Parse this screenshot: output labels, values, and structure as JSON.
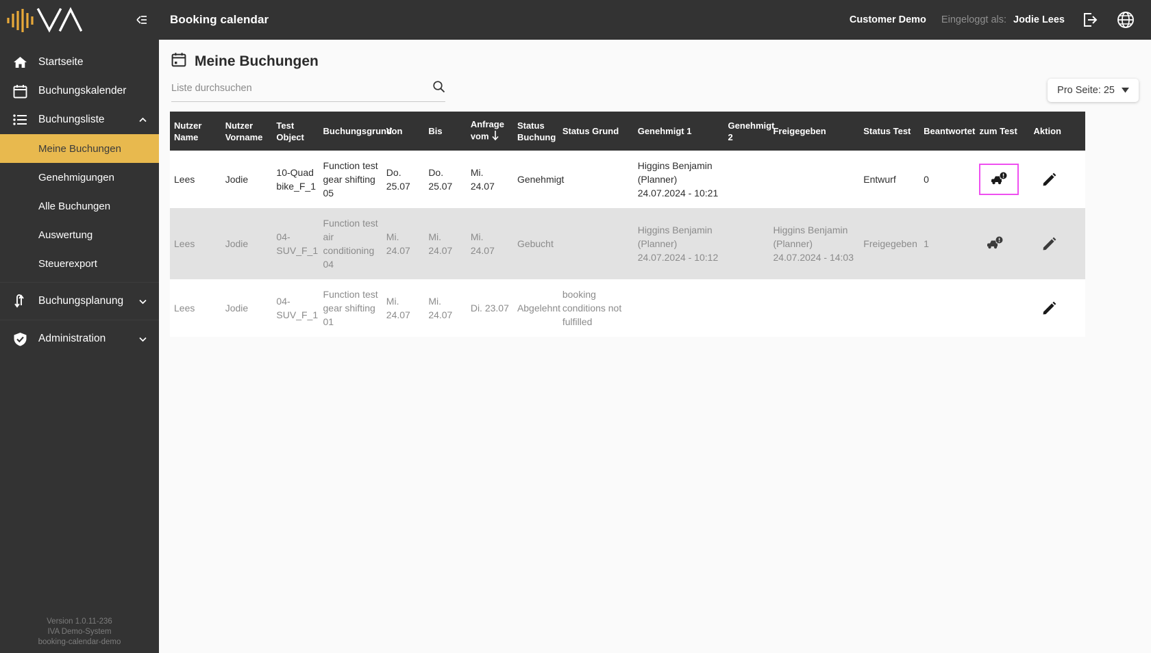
{
  "sidebar": {
    "logo_name": "iva-logo",
    "collapse_icon": "collapse-panel-icon",
    "items": [
      {
        "label": "Startseite",
        "icon": "home-icon",
        "type": "link"
      },
      {
        "label": "Buchungskalender",
        "icon": "calendar-icon",
        "type": "link"
      },
      {
        "label": "Buchungsliste",
        "icon": "list-icon",
        "type": "group",
        "expanded": true,
        "chevron": "chevron-up-icon"
      },
      {
        "label": "Meine Buchungen",
        "type": "sub",
        "active": true
      },
      {
        "label": "Genehmigungen",
        "type": "sub",
        "active": false
      },
      {
        "label": "Alle Buchungen",
        "type": "sub",
        "active": false
      },
      {
        "label": "Auswertung",
        "type": "sub",
        "active": false
      },
      {
        "label": "Steuerexport",
        "type": "sub",
        "active": false
      },
      {
        "label": "Buchungsplanung",
        "icon": "swap-icon",
        "type": "group",
        "expanded": false,
        "chevron": "chevron-down-icon"
      },
      {
        "label": "Administration",
        "icon": "shield-check-icon",
        "type": "group",
        "expanded": false,
        "chevron": "chevron-down-icon"
      }
    ],
    "footer": {
      "version": "Version 1.0.11-236",
      "system": "IVA Demo-System",
      "tenant": "booking-calendar-demo"
    }
  },
  "header": {
    "title": "Booking calendar",
    "customer": "Customer Demo",
    "logged_in_label": "Eingeloggt als:",
    "user": "Jodie Lees",
    "logout_icon": "logout-icon",
    "language_icon": "globe-icon"
  },
  "page": {
    "title": "Meine Buchungen",
    "title_icon": "calendar-icon"
  },
  "search": {
    "placeholder": "Liste durchsuchen",
    "value": "",
    "icon": "search-icon"
  },
  "per_page": {
    "label": "Pro Seite: 25",
    "chevron": "chevron-down-icon"
  },
  "table": {
    "columns": [
      "Nutzer Name",
      "Nutzer Vorname",
      "Test Object",
      "Buchungsgrund",
      "Von",
      "Bis",
      "Anfrage vom",
      "Status Buchung",
      "Status Grund",
      "Genehmigt 1",
      "Genehmigt 2",
      "Freigegeben",
      "Status Test",
      "Beantwortet",
      "zum Test",
      "Aktion"
    ],
    "sorted_column": "Anfrage vom",
    "sort_direction": "desc",
    "sort_icon": "arrow-down-icon",
    "rows": [
      {
        "nutzer_name": "Lees",
        "nutzer_vorname": "Jodie",
        "test_object": "10-Quad bike_F_1",
        "buchungsgrund": "Function test gear shifting 05",
        "von": "Do. 25.07",
        "bis": "Do. 25.07",
        "anfrage_vom": "Mi. 24.07",
        "status_buchung": "Genehmigt",
        "status_grund": "",
        "genehmigt_1": "Higgins Benjamin (Planner) 24.07.2024 - 10:21",
        "genehmigt_2": "",
        "freigegeben": "",
        "status_test": "Entwurf",
        "beantwortet": "0",
        "zum_test_icon": "car-alert-icon",
        "zum_test_highlighted": true,
        "aktion_icon": "pencil-icon",
        "dim": false
      },
      {
        "nutzer_name": "Lees",
        "nutzer_vorname": "Jodie",
        "test_object": "04-SUV_F_1",
        "buchungsgrund": "Function test air conditioning 04",
        "von": "Mi. 24.07",
        "bis": "Mi. 24.07",
        "anfrage_vom": "Mi. 24.07",
        "status_buchung": "Gebucht",
        "status_grund": "",
        "genehmigt_1": "Higgins Benjamin (Planner) 24.07.2024 - 10:12",
        "genehmigt_2": "",
        "freigegeben": "Higgins Benjamin (Planner) 24.07.2024 - 14:03",
        "status_test": "Freigegeben",
        "beantwortet": "1",
        "zum_test_icon": "car-alert-icon",
        "zum_test_highlighted": false,
        "aktion_icon": "pencil-icon",
        "dim": true
      },
      {
        "nutzer_name": "Lees",
        "nutzer_vorname": "Jodie",
        "test_object": "04-SUV_F_1",
        "buchungsgrund": "Function test gear shifting 01",
        "von": "Mi. 24.07",
        "bis": "Mi. 24.07",
        "anfrage_vom": "Di. 23.07",
        "status_buchung": "Abgelehnt",
        "status_grund": "booking conditions not fulfilled",
        "genehmigt_1": "",
        "genehmigt_2": "",
        "freigegeben": "",
        "status_test": "",
        "beantwortet": "",
        "zum_test_icon": "",
        "zum_test_highlighted": false,
        "aktion_icon": "pencil-icon",
        "dim": false
      }
    ]
  },
  "colors": {
    "sidebar_bg": "#333333",
    "accent": "#e8b94e",
    "highlight_border": "#ef4ff0",
    "row_dim_bg": "#e2e2e2"
  }
}
